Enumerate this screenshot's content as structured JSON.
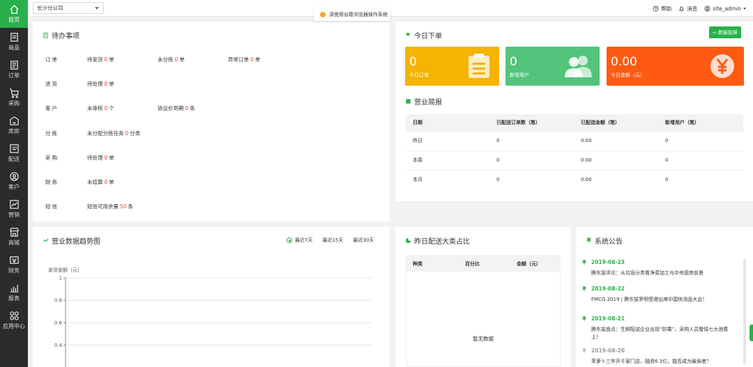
{
  "sidebar": {
    "items": [
      {
        "label": "首页",
        "icon": "home-icon"
      },
      {
        "label": "商品",
        "icon": "goods-icon"
      },
      {
        "label": "订单",
        "icon": "order-icon"
      },
      {
        "label": "采购",
        "icon": "cart-icon"
      },
      {
        "label": "库房",
        "icon": "warehouse-icon"
      },
      {
        "label": "配送",
        "icon": "delivery-icon"
      },
      {
        "label": "客户",
        "icon": "customer-icon"
      },
      {
        "label": "营销",
        "icon": "marketing-icon"
      },
      {
        "label": "商城",
        "icon": "store-icon"
      },
      {
        "label": "财务",
        "icon": "finance-icon"
      },
      {
        "label": "报表",
        "icon": "report-icon"
      },
      {
        "label": "应用中心",
        "icon": "apps-icon"
      }
    ]
  },
  "topbar": {
    "company": "长沙分公司",
    "notice": "请使用谷歌浏览器操作系统",
    "help": "帮助",
    "messages": "消息",
    "user": "site_admin"
  },
  "todo": {
    "title": "待办事项",
    "rows": [
      {
        "category": "订单",
        "items": [
          {
            "text": "待发货",
            "count": "0",
            "unit": "单"
          },
          {
            "text": "未分拣",
            "count": "0",
            "unit": "单"
          },
          {
            "text": "异常订单",
            "count": "0",
            "unit": "单"
          }
        ]
      },
      {
        "category": "退货",
        "items": [
          {
            "text": "待处理",
            "count": "0",
            "unit": "单"
          }
        ]
      },
      {
        "category": "客户",
        "items": [
          {
            "text": "未审核",
            "count": "0",
            "unit": "个"
          },
          {
            "text": "协议价到期",
            "count": "0",
            "unit": "条"
          }
        ]
      },
      {
        "category": "分拣",
        "items": [
          {
            "text": "未分配分拣任务",
            "count": "0",
            "unit": "分类"
          }
        ]
      },
      {
        "category": "采购",
        "items": [
          {
            "text": "待处理",
            "count": "0",
            "unit": "单"
          }
        ]
      },
      {
        "category": "财务",
        "items": [
          {
            "text": "未结算",
            "count": "0",
            "unit": "单"
          }
        ]
      },
      {
        "category": "短信",
        "items": [
          {
            "text": "短信可用余量",
            "count": "50",
            "unit": "条"
          }
        ]
      }
    ]
  },
  "today": {
    "title": "今日下单",
    "export_label": "数据投屏",
    "stats": [
      {
        "value": "0",
        "label": "今日订单",
        "color": "#f4b400"
      },
      {
        "value": "0",
        "label": "新增用户",
        "color": "#52c47c"
      },
      {
        "value": "0.00",
        "label": "今日金额（元）",
        "color": "#fe5a12"
      }
    ]
  },
  "summary": {
    "title": "营业简报",
    "columns": [
      "日期",
      "已配送订单数（笔）",
      "已配送金额（笔）",
      "新增用户（笔）"
    ],
    "rows": [
      [
        "昨日",
        "0",
        "0.00",
        "0"
      ],
      [
        "本周",
        "0",
        "0.00",
        "0"
      ],
      [
        "本月",
        "0",
        "0.00",
        "0"
      ]
    ]
  },
  "trend": {
    "title": "营业数据趋势图",
    "ranges": [
      "最近7天",
      "最近15天",
      "最近30天"
    ],
    "selected_range": "最近7天"
  },
  "chart_data": {
    "type": "line",
    "ylabel": "发货金额（元）",
    "yticks": [
      "1",
      "0.8",
      "0.6",
      "0.4"
    ],
    "ylim": [
      0,
      1
    ],
    "series": []
  },
  "category_share": {
    "title": "昨日配送大类占比",
    "columns": [
      "种类",
      "百分比",
      "金额（元）"
    ],
    "empty_text": "暂无数据"
  },
  "announcements": {
    "title": "系统公告",
    "items": [
      {
        "date": "2019-08-23",
        "text": "腾东拔评论：从垃圾分类看净菜加工与中央厨房前景"
      },
      {
        "date": "2019-08-22",
        "text": "FMCG 2019 | 腾东拔罗明受邀出席中国快消品大会！"
      },
      {
        "date": "2019-08-21",
        "text": "腾东拔盘点：生鲜配送企业出现“防霉”，采购人员警惕七大浪费上！"
      },
      {
        "date": "2019-08-20",
        "text": "苯萝卜三年开千家门店，融资6.3亿，能否成为破局者？"
      }
    ]
  },
  "colors": {
    "accent": "#29b04a",
    "sidebar_bg": "#2b2b2b",
    "highlight": "#f03c3c"
  }
}
